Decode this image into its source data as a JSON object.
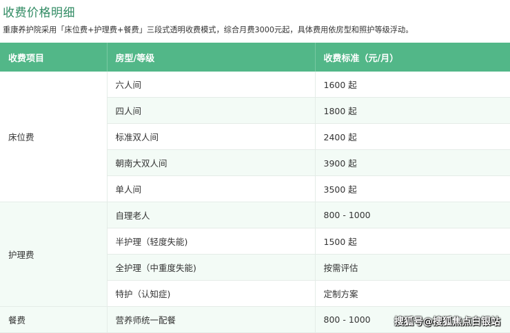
{
  "title": "收费价格明细",
  "intro": "重康养护院采用「床位费+护理费+餐费」三段式透明收费模式，综合月费3000元起，具体费用依房型和照护等级浮动。",
  "table": {
    "headers": [
      "收费项目",
      "房型/等级",
      "收费标准（元/月）"
    ],
    "groups": [
      {
        "category": "床位费",
        "rows": [
          {
            "item": "六人间",
            "price": "1600 起"
          },
          {
            "item": "四人间",
            "price": "1800 起"
          },
          {
            "item": "标准双人间",
            "price": "2400 起"
          },
          {
            "item": "朝南大双人间",
            "price": "3900 起"
          },
          {
            "item": "单人间",
            "price": "3500 起"
          }
        ]
      },
      {
        "category": "护理费",
        "rows": [
          {
            "item": "自理老人",
            "price": "800 - 1000"
          },
          {
            "item": "半护理（轻度失能)",
            "price": "1500 起"
          },
          {
            "item": "全护理（中重度失能)",
            "price": "按需评估"
          },
          {
            "item": "特护（认知症)",
            "price": "定制方案"
          }
        ]
      },
      {
        "category": "餐费",
        "rows": [
          {
            "item": "营养师统一配餐",
            "price": "800 - 1000"
          }
        ]
      }
    ]
  },
  "watermark": "搜狐号@搜狐焦点白银站"
}
